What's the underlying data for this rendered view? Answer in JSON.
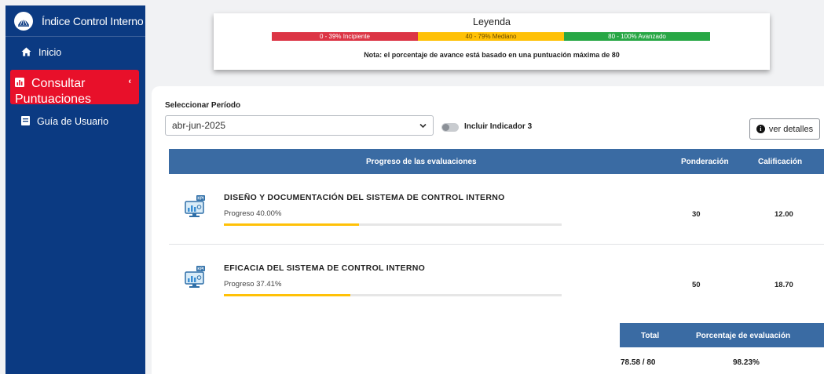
{
  "sidebar": {
    "app_title": "Índice Control Interno",
    "items": [
      {
        "label": "Inicio",
        "icon": "home-icon"
      },
      {
        "label_line1": "Consultar",
        "label_line2": "Puntuaciones",
        "icon": "chart-icon",
        "active": true
      },
      {
        "label": "Guía de Usuario",
        "icon": "book-icon"
      }
    ]
  },
  "legend": {
    "title": "Leyenda",
    "segments": [
      {
        "label": "0 - 39% Incipiente",
        "color": "#dc3545"
      },
      {
        "label": "40 - 79% Mediano",
        "color": "#ffc107"
      },
      {
        "label": "80 - 100% Avanzado",
        "color": "#28a745"
      }
    ],
    "note": "Nota: el porcentaje de avance está basado en una puntuación máxima de 80"
  },
  "filters": {
    "period_label": "Seleccionar Período",
    "period_value": "abr-jun-2025",
    "toggle_label": "Incluir Indicador 3",
    "toggle_on": false,
    "details_button": "ver detalles"
  },
  "table": {
    "headers": {
      "progress": "Progreso de las evaluaciones",
      "weight": "Ponderación",
      "score": "Calificación"
    },
    "rows": [
      {
        "title": "DISEÑO Y DOCUMENTACIÓN DEL SISTEMA DE CONTROL INTERNO",
        "progress_text": "Progreso 40.00%",
        "progress": 40.0,
        "weight": "30",
        "score": "12.00"
      },
      {
        "title": "EFICACIA DEL SISTEMA DE CONTROL INTERNO",
        "progress_text": "Progreso 37.41%",
        "progress": 37.41,
        "weight": "50",
        "score": "18.70"
      }
    ]
  },
  "summary": {
    "total_label": "Total",
    "pct_label": "Porcentaje de evaluación",
    "total_value": "78.58 / 80",
    "pct_value": "98.23%"
  },
  "colors": {
    "sidebar": "#0b3a82",
    "active": "#e8102a",
    "table_header": "#3a6ba3",
    "progress": "#ffc107"
  }
}
